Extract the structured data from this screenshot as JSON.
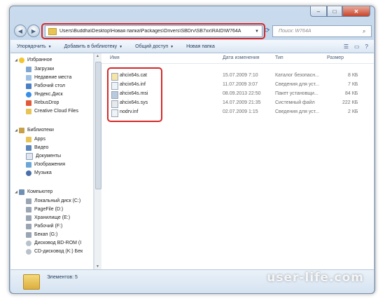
{
  "address": {
    "path": "Users\\Buddha\\Desktop\\Новая папка\\Packages\\Drivers\\SBDrv\\SB7xx\\RAID\\W764A"
  },
  "search": {
    "placeholder": "Поиск: W764A"
  },
  "toolbar": {
    "organize": "Упорядочить",
    "add_library": "Добавить в библиотеку",
    "share": "Общий доступ",
    "new_folder": "Новая папка"
  },
  "nav": {
    "favorites": {
      "label": "Избранное",
      "items": [
        "Загрузки",
        "Недавние места",
        "Рабочий стол",
        "Яндекс.Диск",
        "RebusDrop",
        "Creative Cloud Files"
      ]
    },
    "libraries": {
      "label": "Библиотеки",
      "items": [
        "Apps",
        "Видео",
        "Документы",
        "Изображения",
        "Музыка"
      ]
    },
    "computer": {
      "label": "Компьютер",
      "items": [
        "Локальный диск (C:)",
        "PageFile (D:)",
        "Хранилище (E:)",
        "Рабочий (F:)",
        "Бекап (G:)",
        "Дисковод BD-ROM (I",
        "CD-дисковод (K:) Бек"
      ]
    }
  },
  "columns": {
    "name": "Имя",
    "date": "Дата изменения",
    "type": "Тип",
    "size": "Размер"
  },
  "files": [
    {
      "name": "ahcix64s.cat",
      "date": "15.07.2009 7:10",
      "type": "Каталог безопасн...",
      "size": "8 КБ"
    },
    {
      "name": "ahcix64s.inf",
      "date": "11.07.2009 3:07",
      "type": "Сведения для уст...",
      "size": "7 КБ"
    },
    {
      "name": "ahcix64s.msi",
      "date": "08.09.2013 22:50",
      "type": "Пакет установщи...",
      "size": "84 КБ"
    },
    {
      "name": "ahcix64s.sys",
      "date": "14.07.2009 21:35",
      "type": "Системный файл",
      "size": "222 КБ"
    },
    {
      "name": "nodrv.inf",
      "date": "02.07.2009 1:15",
      "type": "Сведения для уст...",
      "size": "2 КБ"
    }
  ],
  "status": {
    "count": "Элементов: 5"
  },
  "watermark": "user-life.com",
  "colors": {
    "highlight": "#d62828",
    "chrome": "#c9dbed"
  }
}
